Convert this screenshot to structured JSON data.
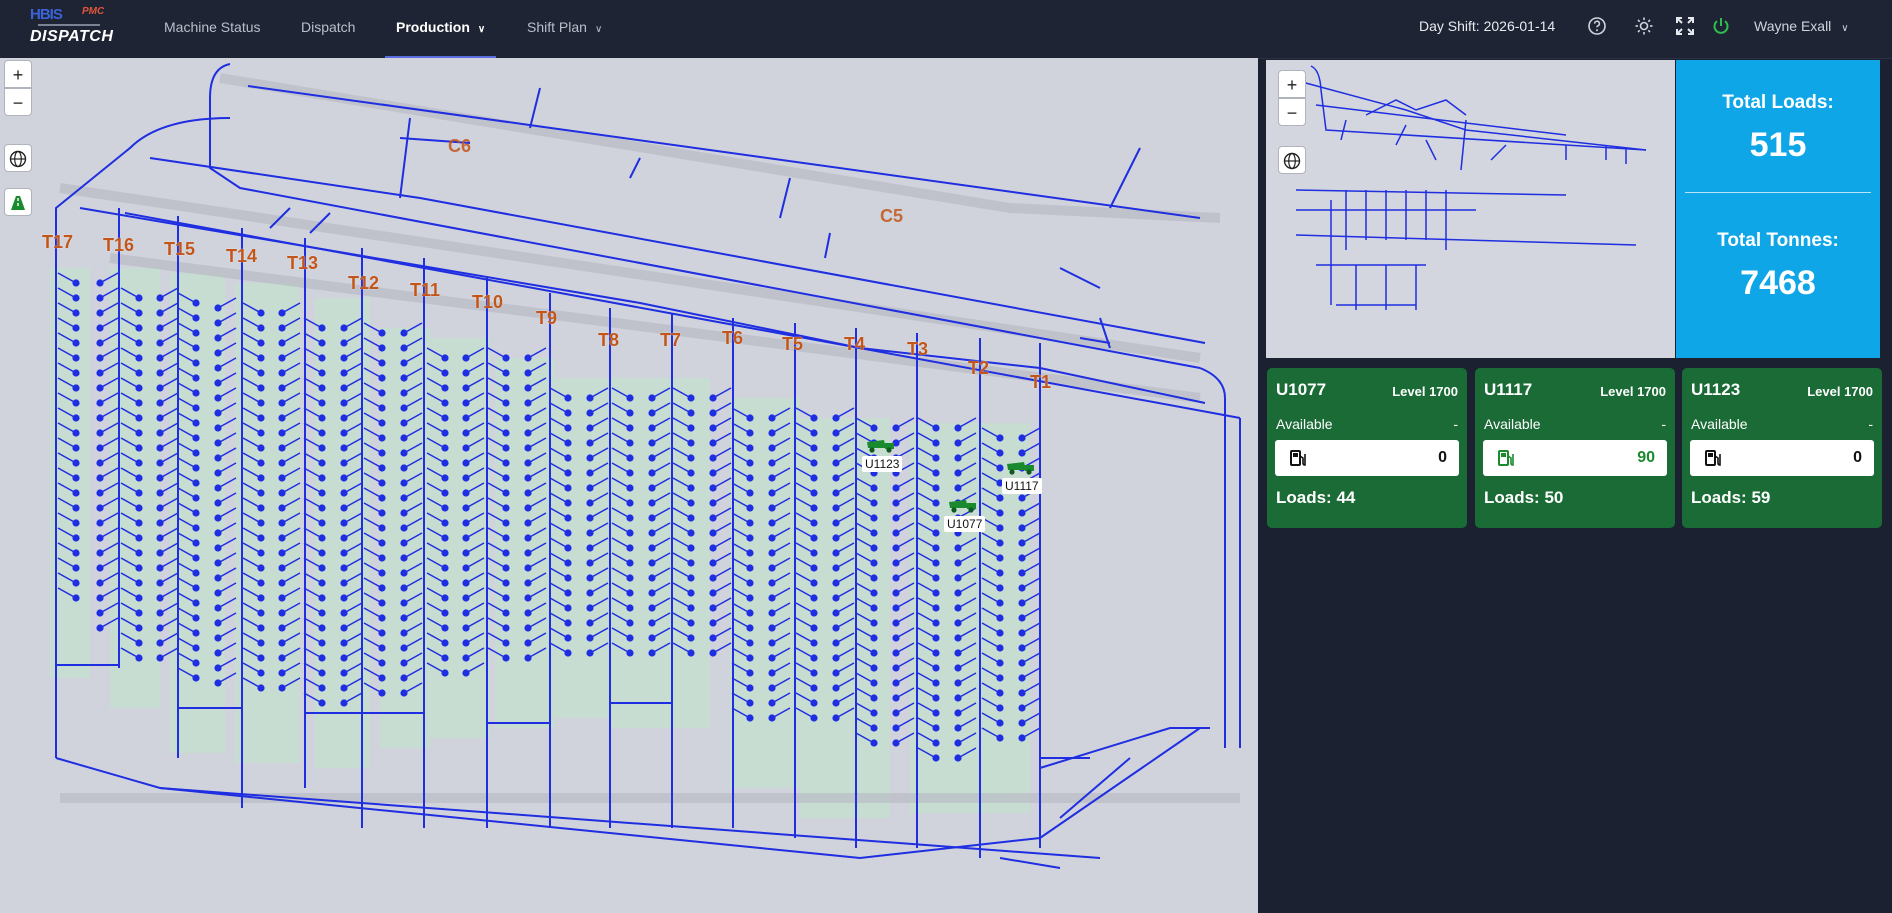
{
  "brand": {
    "logo_top": "HBIS",
    "logo_pmc": "PMC",
    "logo_bottom": "DISPATCH"
  },
  "nav": [
    {
      "label": "Machine Status"
    },
    {
      "label": "Dispatch"
    },
    {
      "label": "Production"
    },
    {
      "label": "Shift Plan"
    }
  ],
  "header": {
    "shift": "Day Shift: 2026-01-14",
    "user": "Wayne Exall"
  },
  "map": {
    "zoom_in": "+",
    "zoom_out": "−",
    "labels": [
      "T17",
      "T16",
      "T15",
      "T14",
      "T13",
      "T12",
      "T11",
      "T10",
      "T9",
      "T8",
      "T7",
      "T6",
      "T5",
      "T4",
      "T3",
      "T2",
      "T1"
    ],
    "zone_labels": [
      "C6",
      "C5"
    ],
    "trucks": [
      "U1123",
      "U1117",
      "U1077"
    ]
  },
  "totals": {
    "loads_label": "Total Loads:",
    "loads_value": "515",
    "tonnes_label": "Total Tonnes:",
    "tonnes_value": "7468"
  },
  "cards": [
    {
      "unit": "U1077",
      "level": "Level 1700",
      "status": "Available",
      "dash": "-",
      "fuel": "0",
      "fuel_color": "#111111",
      "loads": "Loads: 44"
    },
    {
      "unit": "U1117",
      "level": "Level 1700",
      "status": "Available",
      "dash": "-",
      "fuel": "90",
      "fuel_color": "#1a8a2e",
      "loads": "Loads: 50"
    },
    {
      "unit": "U1123",
      "level": "Level 1700",
      "status": "Available",
      "dash": "-",
      "fuel": "0",
      "fuel_color": "#111111",
      "loads": "Loads: 59"
    }
  ],
  "colors": {
    "header_bg": "#1e2433",
    "accent": "#5b6ee1",
    "totals_bg": "#0fa6e8",
    "card_bg": "#1a6b36",
    "route_blue": "#1f2ee0",
    "label_orange": "#c2561a"
  }
}
